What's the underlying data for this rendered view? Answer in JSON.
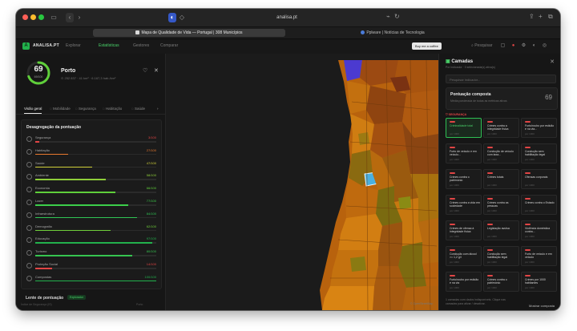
{
  "browser": {
    "url": "analisa.pt",
    "tabs": [
      {
        "label": "Mapa de Qualidade de Vida — Portugal | 308 Municípios",
        "active": true,
        "color": "#d9d9d9"
      },
      {
        "label": "Pplware | Notícias de Tecnologia",
        "active": false,
        "color": "#4a7bd8"
      }
    ]
  },
  "app": {
    "logo_letter": "A",
    "brand": "ANALISA.PT",
    "nav": [
      "Explorar",
      "Estatísticas",
      "Gestores",
      "Comparar"
    ],
    "active_nav": "Estatísticas",
    "buy_button": "Buy me a coffee",
    "search_placeholder": "Pesquisar"
  },
  "place": {
    "score": "69",
    "score_unit": "69/100",
    "name": "Porto",
    "meta": "⊙ 252 837 · 41 km² · 6.167,3 hab./km²"
  },
  "subtabs": [
    "Visão geral",
    "Mobilidade",
    "Segurança",
    "Habitação",
    "Saúde"
  ],
  "breakdown": {
    "title": "Desagregação da pontuação",
    "rows": [
      {
        "label": "Segurança",
        "value": "3/100",
        "pct": 0.03,
        "color": "#e04545"
      },
      {
        "label": "Habitação",
        "value": "27/100",
        "pct": 0.27,
        "color": "#e8792f"
      },
      {
        "label": "Saúde",
        "value": "47/100",
        "pct": 0.47,
        "color": "#cfcf3a"
      },
      {
        "label": "Ambiente",
        "value": "58/100",
        "pct": 0.58,
        "color": "#8fcf3a"
      },
      {
        "label": "Economia",
        "value": "66/100",
        "pct": 0.66,
        "color": "#5fcf3a"
      },
      {
        "label": "Lazer",
        "value": "77/100",
        "pct": 0.77,
        "color": "#3ccf4a"
      },
      {
        "label": "Infraestrutura",
        "value": "84/100",
        "pct": 0.84,
        "color": "#2fc454"
      },
      {
        "label": "Demografia",
        "value": "62/100",
        "pct": 0.62,
        "color": "#6fcf3a"
      },
      {
        "label": "Educação",
        "value": "97/100",
        "pct": 0.97,
        "color": "#22b14c"
      },
      {
        "label": "Turismo",
        "value": "80/100",
        "pct": 0.8,
        "color": "#36c450"
      },
      {
        "label": "Proteção Social",
        "value": "14/100",
        "pct": 0.14,
        "color": "#e04545"
      },
      {
        "label": "Compostas",
        "value": "100/100",
        "pct": 1.0,
        "color": "#22b14c"
      }
    ]
  },
  "lens": {
    "title": "Lente de pontuação",
    "badge": "Explorador"
  },
  "left_footer": {
    "left": "Índice de Segurança (IS)",
    "right": "Porto"
  },
  "layers": {
    "title": "Camadas",
    "subtitle": "Por indicador · 0 selecionada(s) ativa(s)",
    "search_placeholder": "Pesquisar indicador...",
    "composite_title": "Pontuação composta",
    "composite_sub": "Média ponderada de todas as métricas ativas",
    "composite_value": "69",
    "category": "SEGURANÇA",
    "cards": [
      {
        "title": "Criminalidade total",
        "meta": "por 1000",
        "selected": true
      },
      {
        "title": "Crimes contra a integridade física",
        "meta": "por 1000",
        "selected": false
      },
      {
        "title": "Furto/roubo por esticão e na via...",
        "meta": "por 1000",
        "selected": false
      },
      {
        "title": "Furto de veículo e em veículo...",
        "meta": "por 1000",
        "selected": false
      },
      {
        "title": "Condução de veículo com taxa...",
        "meta": "por 1000",
        "selected": false
      },
      {
        "title": "Condução sem habilitação legal",
        "meta": "por 1000",
        "selected": false
      },
      {
        "title": "Crimes contra o património",
        "meta": "por 1000",
        "selected": false
      },
      {
        "title": "Crimes totais",
        "meta": "por 1000",
        "selected": false
      },
      {
        "title": "Ofensas corporais",
        "meta": "por 1000",
        "selected": false
      },
      {
        "title": "Crimes contra a vida em sociedade",
        "meta": "por 1000",
        "selected": false
      },
      {
        "title": "Crimes contra as pessoas",
        "meta": "por 1000",
        "selected": false
      },
      {
        "title": "Crimes contra o Estado",
        "meta": "por 1000",
        "selected": false
      },
      {
        "title": "Crimes de ofensa à integridade física",
        "meta": "por 1000",
        "selected": false
      },
      {
        "title": "Legislação avulsa",
        "meta": "por 1000",
        "selected": false
      },
      {
        "title": "Violência doméstica contra...",
        "meta": "por 1000",
        "selected": false
      },
      {
        "title": "Condução com álcool >= 1,2 g/l",
        "meta": "por 1000",
        "selected": false
      },
      {
        "title": "Condução sem habilitação legal",
        "meta": "por 1000",
        "selected": false
      },
      {
        "title": "Furto de veículo e em veículo",
        "meta": "por 1000",
        "selected": false
      },
      {
        "title": "Furto/roubo por esticão e na via",
        "meta": "por 1000",
        "selected": false
      },
      {
        "title": "Crimes contra o património",
        "meta": "por 1000",
        "selected": false
      },
      {
        "title": "Crimes por 1000 habitantes",
        "meta": "por 1000",
        "selected": false
      }
    ],
    "footer": "1 camadas com dados indisponíveis. Clique nas camadas para ativar / desativar.",
    "footer_button": "Mostrar composta"
  },
  "map": {
    "attribution": "© OpenStreetMap"
  }
}
